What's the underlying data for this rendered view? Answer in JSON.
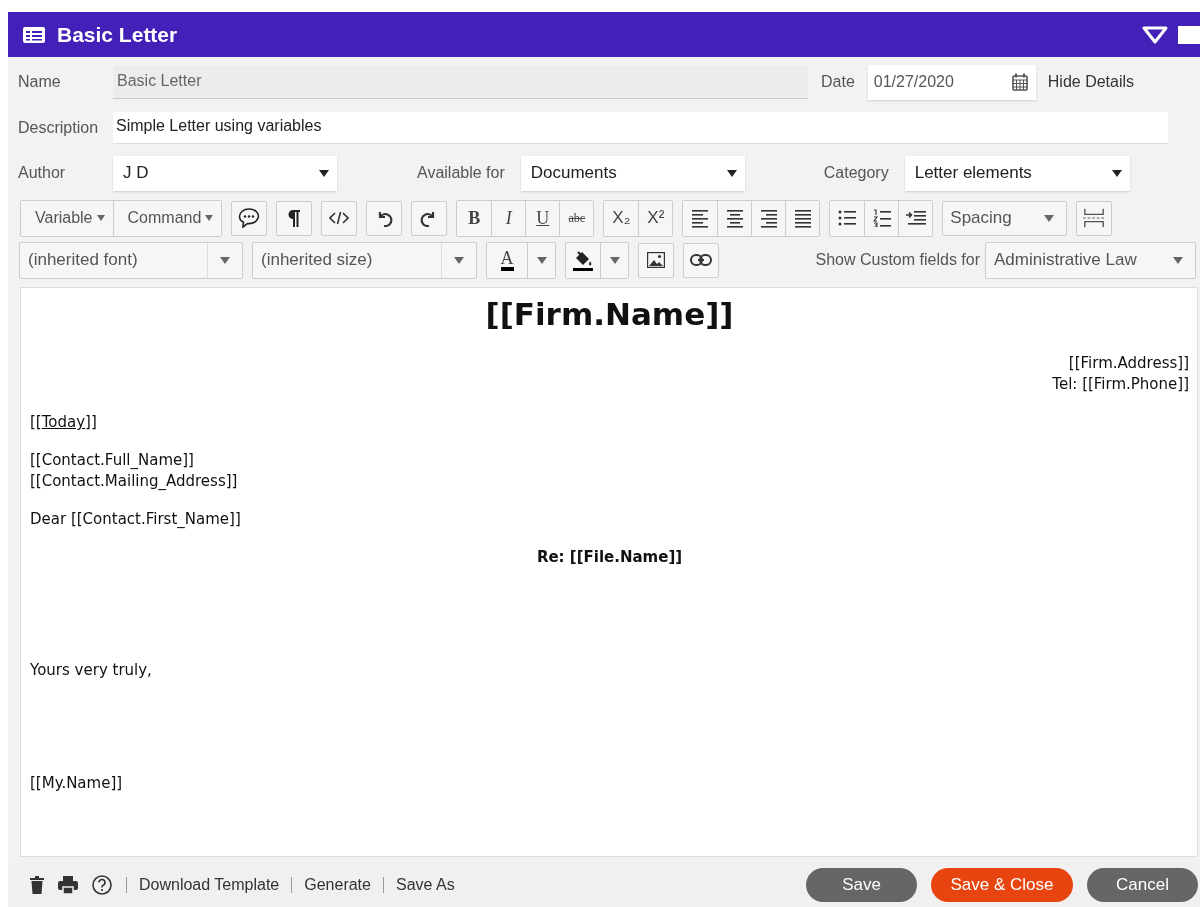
{
  "window": {
    "title": "Basic Letter"
  },
  "details": {
    "name_label": "Name",
    "name_value": "Basic Letter",
    "date_label": "Date",
    "date_value": "01/27/2020",
    "hide_details": "Hide Details",
    "description_label": "Description",
    "description_value": "Simple Letter using variables",
    "selects": [
      {
        "label": "Author",
        "value": "J D"
      },
      {
        "label": "Available for",
        "value": "Documents"
      },
      {
        "label": "Category",
        "value": "Letter elements"
      }
    ]
  },
  "toolbar": {
    "menus": [
      "Variable",
      "Command"
    ],
    "format_buttons": [
      "B",
      "I",
      "U",
      "abc"
    ],
    "script_buttons": [
      "X₂",
      "X²"
    ],
    "spacing": "Spacing",
    "font": "(inherited font)",
    "size": "(inherited size)",
    "text_color_label": "A",
    "custom_fields_label": "Show Custom fields for",
    "custom_fields_value": "Administrative Law"
  },
  "document": {
    "blocks": [
      {
        "kind": "title",
        "lines": [
          [
            {
              "text": "[[Firm.Name]]"
            }
          ]
        ]
      },
      {
        "kind": "address",
        "lines": [
          [
            {
              "text": "[[Firm.Address]]"
            }
          ],
          [
            {
              "text": "Tel: [[Firm.Phone]]"
            }
          ]
        ]
      },
      {
        "kind": "body",
        "lines": [
          [
            {
              "text": "[["
            },
            {
              "text": "Today",
              "underline": true
            },
            {
              "text": "]]"
            }
          ]
        ]
      },
      {
        "kind": "body",
        "lines": [
          [
            {
              "text": "[[Contact.Full_Name]]"
            }
          ],
          [
            {
              "text": "[[Contact.Mailing_Address]]"
            }
          ]
        ]
      },
      {
        "kind": "body",
        "lines": [
          [
            {
              "text": "Dear [[Contact.First_Name]]"
            }
          ]
        ]
      },
      {
        "kind": "subject",
        "lines": [
          [
            {
              "text": "Re: [[File.Name]]"
            }
          ]
        ]
      },
      {
        "kind": "body",
        "lines": [
          [
            {
              "text": "Yours very truly,"
            }
          ]
        ]
      },
      {
        "kind": "body",
        "lines": [
          [
            {
              "text": "[[My.Name]]"
            }
          ]
        ]
      }
    ]
  },
  "footer": {
    "links": [
      "Download Template",
      "Generate",
      "Save As"
    ],
    "buttons": [
      {
        "label": "Save",
        "kind": "secondary"
      },
      {
        "label": "Save & Close",
        "kind": "primary"
      },
      {
        "label": "Cancel",
        "kind": "secondary"
      }
    ]
  }
}
